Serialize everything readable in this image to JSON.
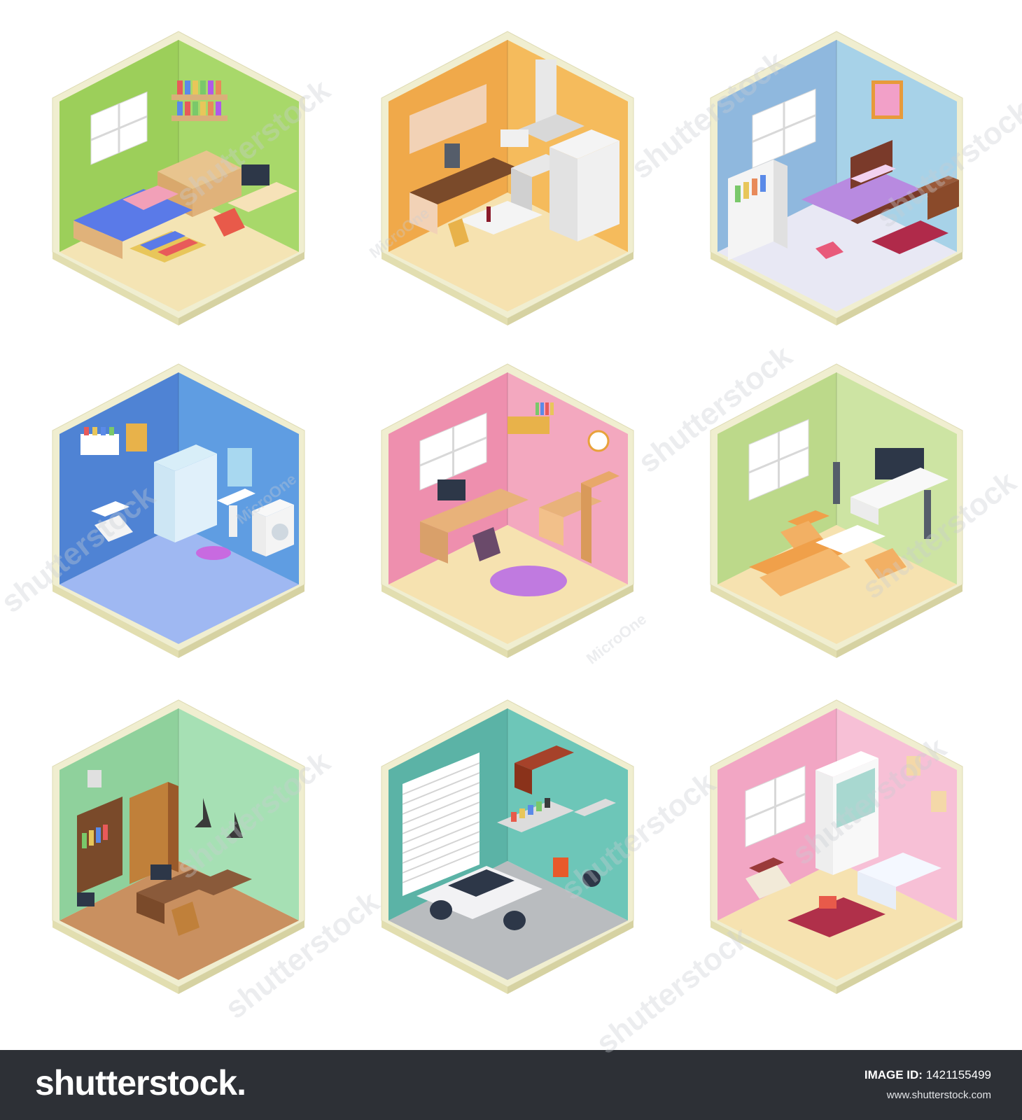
{
  "watermarks": {
    "stock_text": "shutterstock",
    "author_text": "MicroOne"
  },
  "rooms": [
    {
      "name": "bedroom-kids",
      "left_wall": "#9ccf5a",
      "right_wall": "#a8d86a",
      "floor": "#f4e4b4"
    },
    {
      "name": "kitchen",
      "left_wall": "#f0a94a",
      "right_wall": "#f5bb5c",
      "floor": "#f6e2b0"
    },
    {
      "name": "bedroom-master",
      "left_wall": "#8fb8de",
      "right_wall": "#a7d2e8",
      "floor": "#e8e8f4"
    },
    {
      "name": "bathroom",
      "left_wall": "#4f83d4",
      "right_wall": "#5f9de2",
      "floor": "#9fb8f2"
    },
    {
      "name": "study",
      "left_wall": "#ee8fae",
      "right_wall": "#f3a8bf",
      "floor": "#f6e2b0"
    },
    {
      "name": "living-room",
      "left_wall": "#bcd98a",
      "right_wall": "#cde4a3",
      "floor": "#f6e2b0"
    },
    {
      "name": "office",
      "left_wall": "#8fd19c",
      "right_wall": "#a6e0b4",
      "floor": "#c99060"
    },
    {
      "name": "garage",
      "left_wall": "#5bb3a6",
      "right_wall": "#6dc6b8",
      "floor": "#b9bcbf"
    },
    {
      "name": "nursery",
      "left_wall": "#f2a6c4",
      "right_wall": "#f7c0d6",
      "floor": "#f6e2b0"
    }
  ],
  "footer": {
    "logo": "shutterstock.",
    "image_id_label": "IMAGE ID:",
    "image_id": "1421155499",
    "url": "www.shutterstock.com"
  }
}
